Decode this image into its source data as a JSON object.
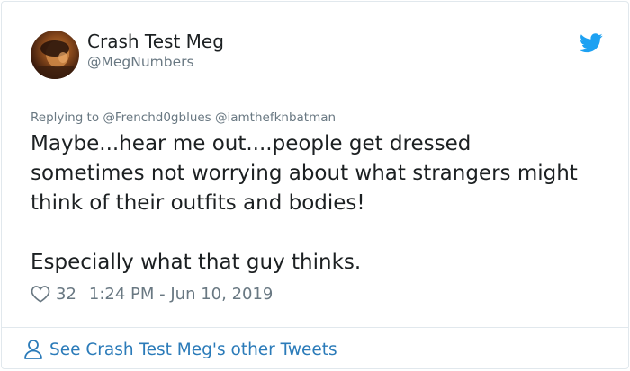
{
  "author": {
    "name": "Crash Test Meg",
    "handle": "@MegNumbers"
  },
  "replying": {
    "text": "Replying to @Frenchd0gblues @iamthefknbatman"
  },
  "tweet": {
    "lines": [
      "Maybe...hear me out....people get dressed",
      "sometimes not worrying about what strangers might",
      "think of their outfits and bodies!",
      "Especially what that guy thinks."
    ]
  },
  "meta": {
    "likes": "32",
    "timestamp": "1:24 PM - Jun 10, 2019"
  },
  "footer": {
    "see_other": "See Crash Test Meg's other Tweets"
  },
  "icons": {
    "brand": "twitter-bird-icon",
    "like": "heart-icon",
    "profile": "person-icon"
  },
  "colors": {
    "brand_blue": "#1da1f2",
    "link_blue": "#2b7bb9",
    "secondary_text": "#697882",
    "primary_text": "#1c2022",
    "border": "#e1e8ed"
  }
}
